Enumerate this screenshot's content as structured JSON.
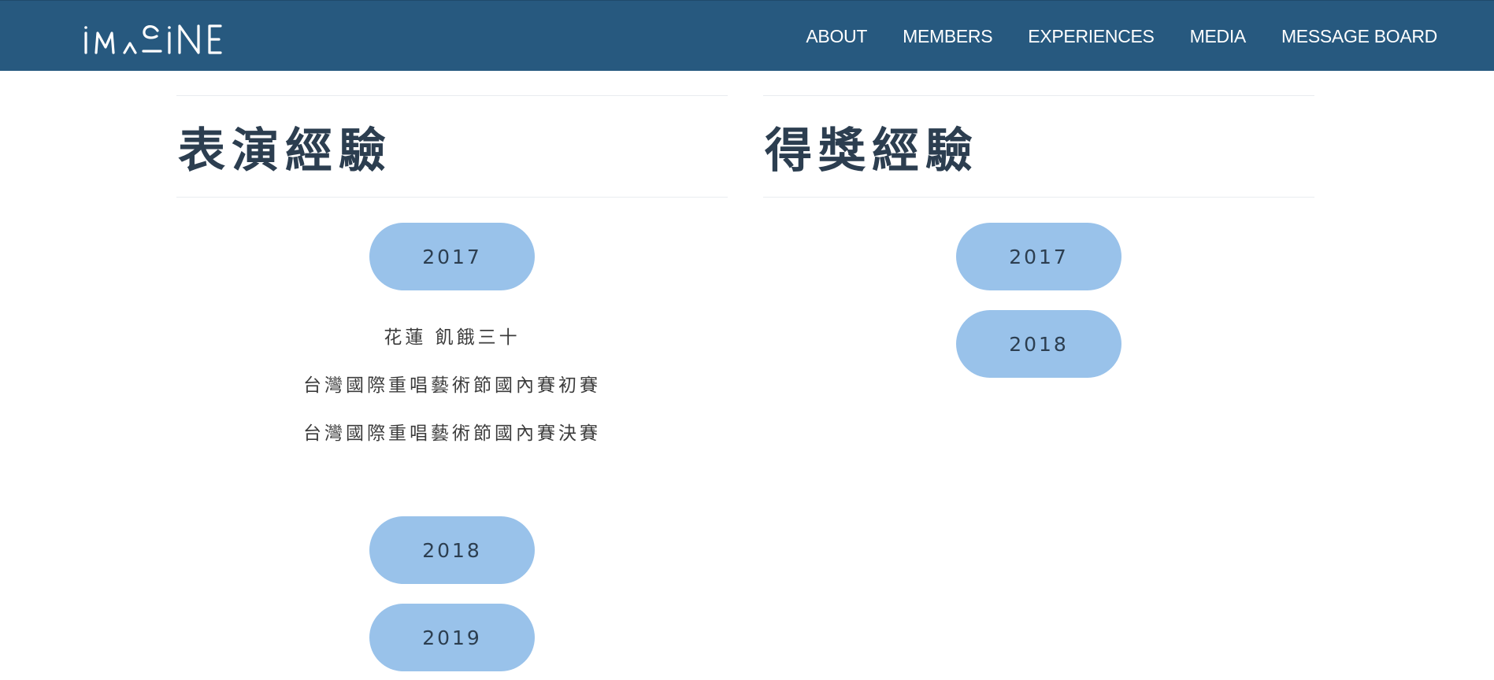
{
  "brand": {
    "logo_text": "IMAGINE"
  },
  "nav": {
    "items": [
      {
        "label": "ABOUT"
      },
      {
        "label": "MEMBERS"
      },
      {
        "label": "EXPERIENCES"
      },
      {
        "label": "MEDIA"
      },
      {
        "label": "MESSAGE BOARD"
      }
    ]
  },
  "colors": {
    "navbar": "#27597f",
    "pill": "#99c2ea",
    "heading": "#2c3e50"
  },
  "performance": {
    "title": "表演經驗",
    "years": [
      {
        "label": "2017",
        "expanded": true,
        "events": [
          "花蓮 飢餓三十",
          "台灣國際重唱藝術節國內賽初賽",
          "台灣國際重唱藝術節國內賽決賽"
        ]
      },
      {
        "label": "2018"
      },
      {
        "label": "2019"
      }
    ]
  },
  "awards": {
    "title": "得獎經驗",
    "years": [
      {
        "label": "2017"
      },
      {
        "label": "2018"
      }
    ]
  }
}
